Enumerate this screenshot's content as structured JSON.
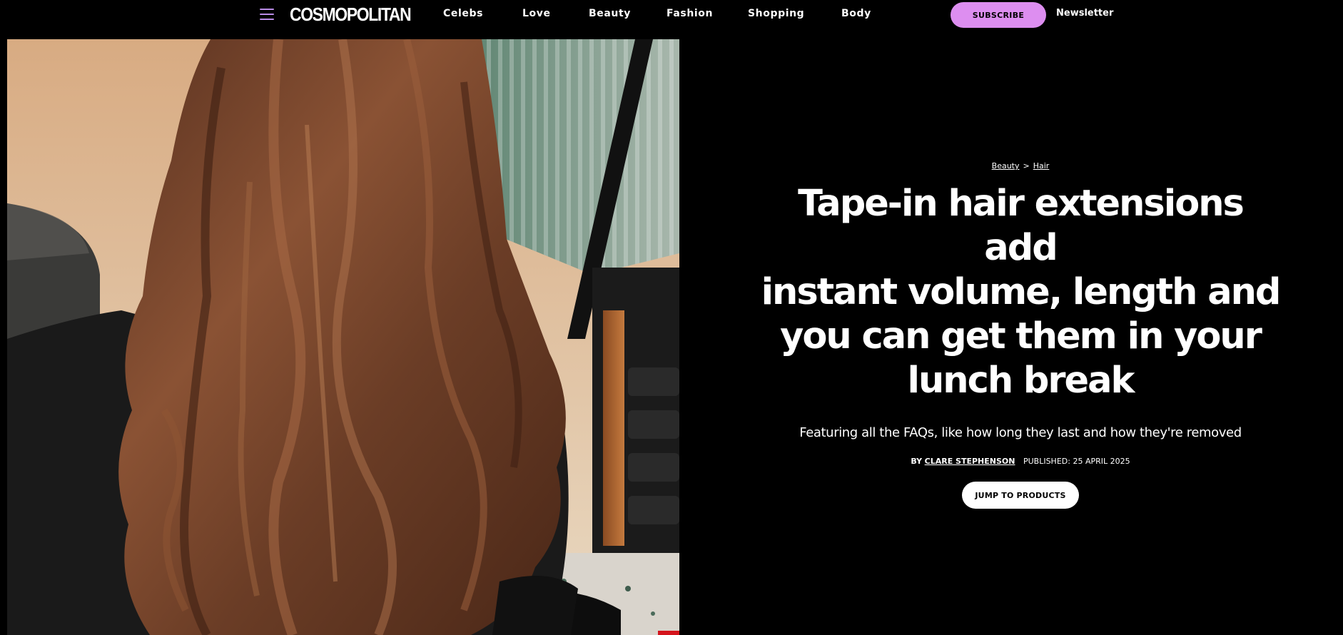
{
  "nav": {
    "logo": "COSMOPOLITAN",
    "links": [
      "Celebs",
      "Love",
      "Beauty",
      "Fashion",
      "Shopping",
      "Body"
    ],
    "subscribe_label": "SUBSCRIBE",
    "newsletter_label": "Newsletter",
    "menu_icon": "hamburger-menu-icon"
  },
  "article": {
    "breadcrumb": [
      "Beauty",
      "Hair"
    ],
    "breadcrumb_separator": ">",
    "headline_lines": [
      "Tape-in hair extensions add",
      "instant volume, length and",
      "you can get them in your",
      "lunch break"
    ],
    "dek": "Featuring all the FAQs, like how long they last and how they're removed",
    "byline_prefix": "BY",
    "author": "CLARE STEPHENSON",
    "published": "PUBLISHED: 25 APRIL 2025",
    "jump_label": "JUMP TO PRODUCTS"
  },
  "colors": {
    "background": "#000000",
    "subscribe_bg": "#dd8ef0",
    "menu_icon": "#b98be6",
    "text": "#ffffff"
  }
}
